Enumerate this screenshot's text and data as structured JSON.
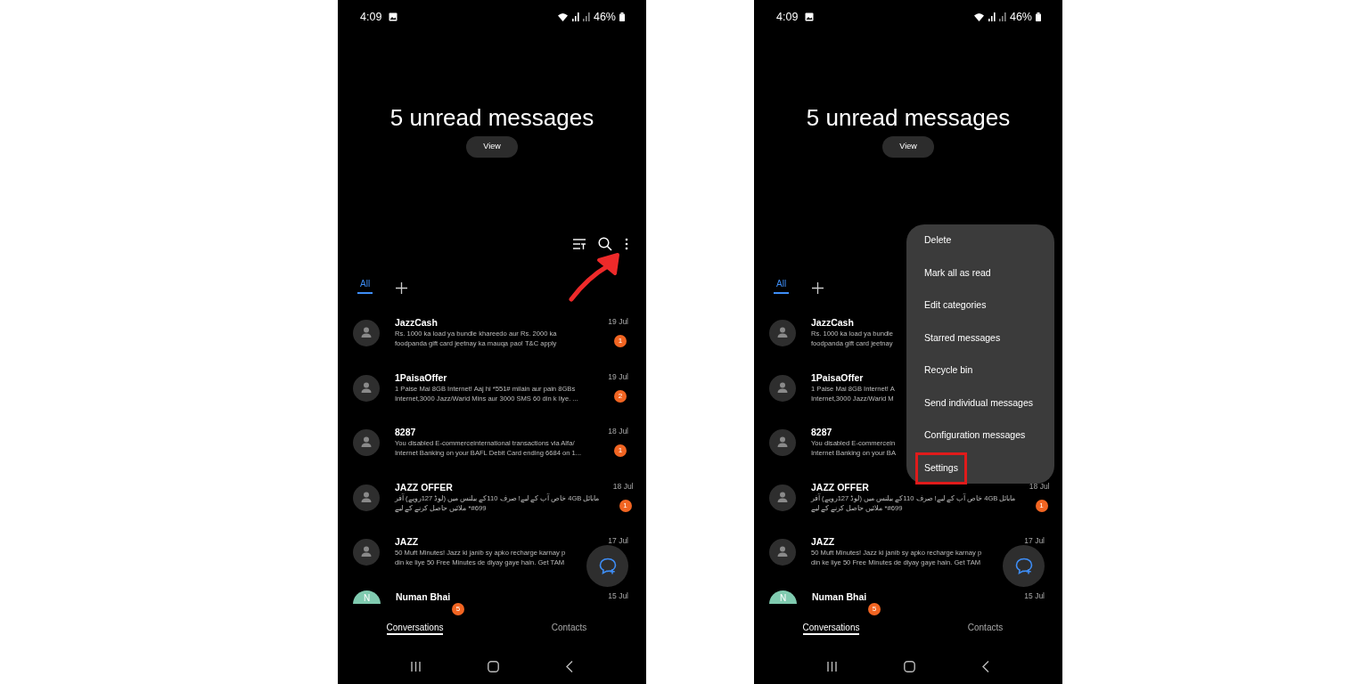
{
  "phones": [
    {
      "status_bar": {
        "time": "4:09",
        "battery": "46%"
      },
      "headline": "5 unread messages",
      "view_button": "View",
      "toolbar": [
        {
          "kind": "sort"
        },
        {
          "kind": "search"
        },
        {
          "kind": "more"
        }
      ],
      "tabs": [
        {
          "label": "All",
          "selected": true
        }
      ],
      "conversations": [
        {
          "name": "JazzCash",
          "preview_lines": [
            "Rs. 1000 ka load ya bundle khareedo aur Rs. 2000 ka",
            "foodpanda gift card jeetnay ka mauqa pao! T&C apply"
          ],
          "date": "19 Jul",
          "unread": "1",
          "avatar": {
            "kind": "person"
          }
        },
        {
          "name": "1PaisaOffer",
          "preview_lines": [
            "1 Paise Mai 8GB Internet! Aaj hi *551# milain aur pain 8GBs",
            "Internet,3000 Jazz/Warid Mins aur 3000 SMS 60 din k liye. ..."
          ],
          "date": "19 Jul",
          "unread": "2",
          "avatar": {
            "kind": "person"
          }
        },
        {
          "name": "8287",
          "preview_lines": [
            "You disabled E-commerceinternational  transactions via Alfa/",
            "Internet Banking on your BAFL Debit Card ending 6684 on 1..."
          ],
          "date": "18 Jul",
          "unread": "1",
          "avatar": {
            "kind": "person"
          }
        },
        {
          "name": "JAZZ OFFER",
          "preview_lines": [
            "مابائل 4GB خاص آپ کے لیے! صرف 110کے بیلنس میں (لوڈ 127روپے) آفر",
            "#699* ملائیں حاصل کرنے کے لیے"
          ],
          "date": "18 Jul",
          "unread": "1",
          "avatar": {
            "kind": "person"
          }
        },
        {
          "name": "JAZZ",
          "preview_lines": [
            "50 Muft Minutes! Jazz ki janib sy apko recharge karnay p",
            "din ke liye 50 Free Minutes de diyay gaye hain. Get TAM"
          ],
          "date": "17 Jul",
          "avatar": {
            "kind": "person"
          }
        },
        {
          "name": "Numan Bhai",
          "date": "15 Jul",
          "avatar": {
            "kind": "initial",
            "initial": "N"
          }
        }
      ],
      "bottom_tabs": [
        {
          "label": "Conversations",
          "selected": true,
          "badge": "5"
        },
        {
          "label": "Contacts",
          "selected": false
        }
      ],
      "annotation": {
        "kind": "arrow"
      }
    },
    {
      "status_bar": {
        "time": "4:09",
        "battery": "46%"
      },
      "headline": "5 unread messages",
      "view_button": "View",
      "tabs": [
        {
          "label": "All",
          "selected": true
        }
      ],
      "conversations": [
        {
          "name": "JazzCash",
          "preview_lines": [
            "Rs. 1000 ka load ya bundle",
            "foodpanda gift card jeetnay"
          ],
          "avatar": {
            "kind": "person"
          }
        },
        {
          "name": "1PaisaOffer",
          "preview_lines": [
            "1 Paise Mai 8GB Internet! A",
            "Internet,3000 Jazz/Warid M"
          ],
          "avatar": {
            "kind": "person"
          }
        },
        {
          "name": "8287",
          "preview_lines": [
            "You disabled E-commercein",
            "Internet Banking on your BA"
          ],
          "avatar": {
            "kind": "person"
          }
        },
        {
          "name": "JAZZ OFFER",
          "preview_lines": [
            "مابائل 4GB خاص آپ کے لیے! صرف 110کے بیلنس میں (لوڈ 127روپے) آفر",
            "#699* ملائیں حاصل کرنے کے لیے"
          ],
          "date": "18 Jul",
          "unread": "1",
          "avatar": {
            "kind": "person"
          }
        },
        {
          "name": "JAZZ",
          "preview_lines": [
            "50 Muft Minutes! Jazz ki janib sy apko recharge karnay p",
            "din ke liye 50 Free Minutes de diyay gaye hain. Get TAM"
          ],
          "date": "17 Jul",
          "avatar": {
            "kind": "person"
          }
        },
        {
          "name": "Numan Bhai",
          "date": "15 Jul",
          "avatar": {
            "kind": "initial",
            "initial": "N"
          }
        }
      ],
      "bottom_tabs": [
        {
          "label": "Conversations",
          "selected": true,
          "badge": "5"
        },
        {
          "label": "Contacts",
          "selected": false
        }
      ],
      "menu": [
        {
          "label": "Delete",
          "highlighted": false
        },
        {
          "label": "Mark all as read",
          "highlighted": false
        },
        {
          "label": "Edit categories",
          "highlighted": false
        },
        {
          "label": "Starred messages",
          "highlighted": false
        },
        {
          "label": "Recycle bin",
          "highlighted": false
        },
        {
          "label": "Send individual messages",
          "highlighted": false
        },
        {
          "label": "Configuration messages",
          "highlighted": false
        },
        {
          "label": "Settings",
          "highlighted": true
        }
      ]
    }
  ]
}
